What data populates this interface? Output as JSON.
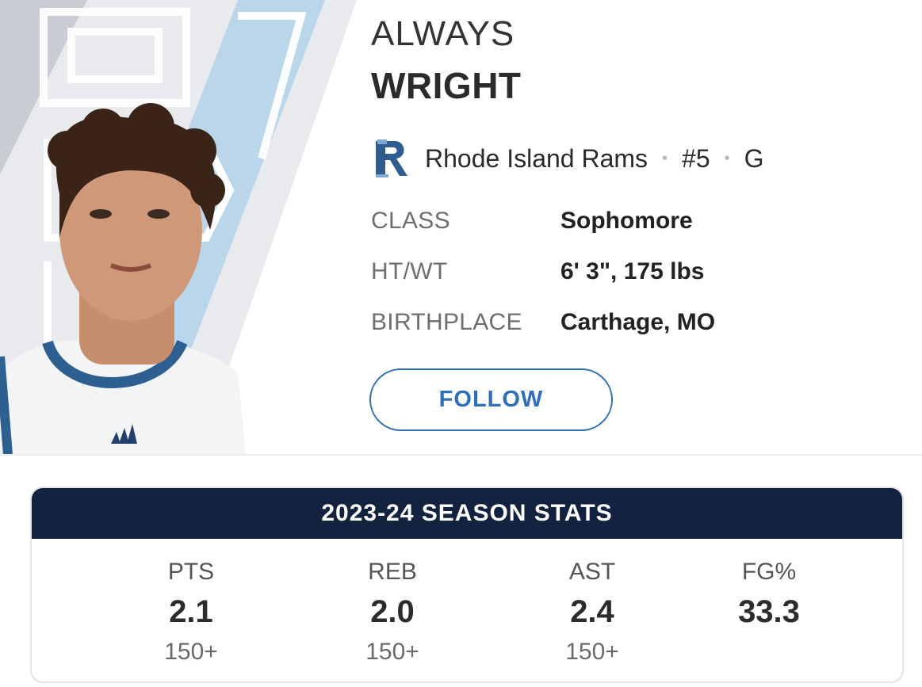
{
  "player": {
    "first_name": "ALWAYS",
    "last_name": "WRIGHT",
    "team": "Rhode Island Rams",
    "separator": "•",
    "jersey": "#5",
    "position": "G",
    "team_logo_icon": "rhode-island-rams-logo-icon",
    "headshot_icon": "player-headshot-photo",
    "info": [
      {
        "label": "CLASS",
        "value": "Sophomore"
      },
      {
        "label": "HT/WT",
        "value": "6' 3\", 175 lbs"
      },
      {
        "label": "BIRTHPLACE",
        "value": "Carthage, MO"
      }
    ],
    "follow_label": "FOLLOW",
    "jersey_brand": "adidas"
  },
  "stats": {
    "title": "2023-24 SEASON STATS",
    "columns": [
      {
        "label": "PTS",
        "value": "2.1",
        "rank": "150+"
      },
      {
        "label": "REB",
        "value": "2.0",
        "rank": "150+"
      },
      {
        "label": "AST",
        "value": "2.4",
        "rank": "150+"
      },
      {
        "label": "FG%",
        "value": "33.3",
        "rank": ""
      }
    ]
  },
  "colors": {
    "accent_blue": "#2f6fba",
    "header_navy": "#13233f",
    "team_light_blue": "#b9d6ea"
  }
}
